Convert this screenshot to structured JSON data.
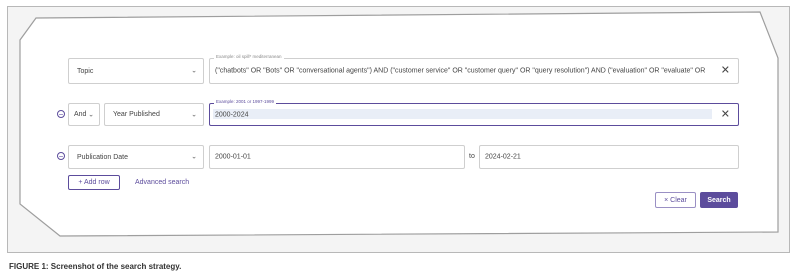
{
  "colors": {
    "accent": "#5c4c9c",
    "border": "#cfcfcf",
    "panel": "#ffffff"
  },
  "row1": {
    "field": "Topic",
    "hint": "Example: oil spill* mediterranean",
    "value": "(\"chatbots\" OR \"Bots\" OR \"conversational agents\") AND (\"customer service\" OR \"customer query\" OR \"query resolution\") AND (\"evaluation\" OR \"evaluate\" OR",
    "clear_icon": "close-icon"
  },
  "row2": {
    "remove_icon": "minus-circle-icon",
    "operator": "And",
    "field": "Year Published",
    "hint": "Example: 2001 or 1997-1999",
    "value": "2000-2024",
    "clear_icon": "close-icon"
  },
  "row3": {
    "remove_icon": "minus-circle-icon",
    "field": "Publication Date",
    "from": "2000-01-01",
    "to_label": "to",
    "to": "2024-02-21"
  },
  "actions": {
    "add_row": "+ Add row",
    "advanced": "Advanced search",
    "clear": "× Clear",
    "search": "Search"
  },
  "caption": "FIGURE 1: Screenshot of the search strategy."
}
